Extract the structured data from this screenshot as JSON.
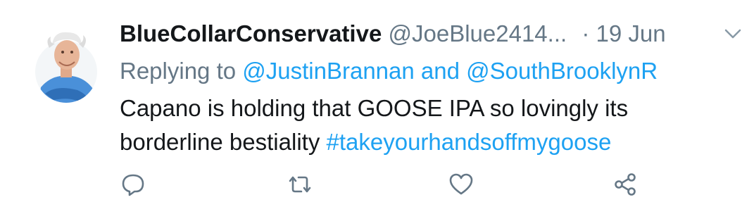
{
  "tweet": {
    "author": {
      "display_name": "BlueCollarConservative",
      "handle": "@JoeBlue2414...",
      "avatar_icon": "avatar-photo"
    },
    "separator": "·",
    "date": "19 Jun",
    "replying_to": {
      "prefix": "Replying to ",
      "user1": "@JustinBrannan",
      "conjunction": " and ",
      "user2": "@SouthBrooklynR"
    },
    "text_line1": "Capano is holding that GOOSE IPA so lovingly its",
    "text_line2_plain": "borderline bestiality ",
    "hashtag": "#takeyourhandsoffmygoose",
    "actions": {
      "reply_icon": "reply-icon",
      "retweet_icon": "retweet-icon",
      "like_icon": "heart-icon",
      "share_icon": "share-icon"
    },
    "colors": {
      "link": "#1da1f2",
      "muted": "#657786",
      "text": "#14171a",
      "icon": "#657786"
    }
  }
}
